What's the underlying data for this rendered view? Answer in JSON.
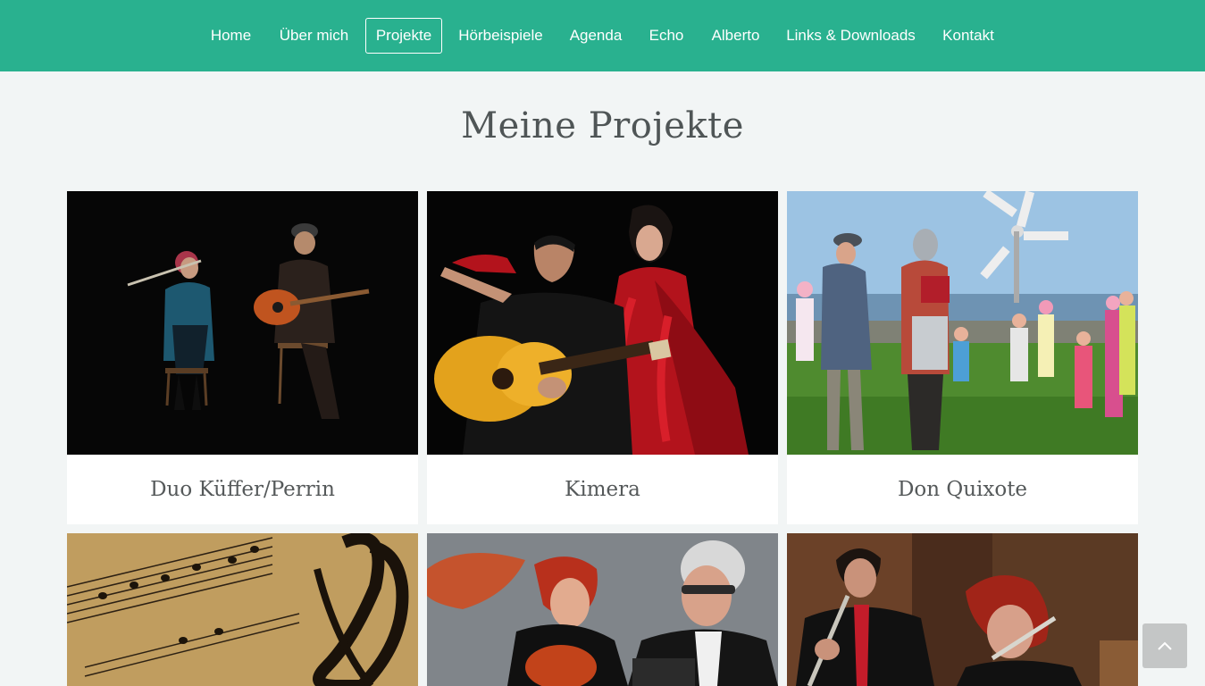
{
  "nav": {
    "items": [
      {
        "label": "Home"
      },
      {
        "label": "Über mich"
      },
      {
        "label": "Projekte",
        "active": true
      },
      {
        "label": "Hörbeispiele"
      },
      {
        "label": "Agenda"
      },
      {
        "label": "Echo"
      },
      {
        "label": "Alberto"
      },
      {
        "label": "Links & Downloads"
      },
      {
        "label": "Kontakt"
      }
    ]
  },
  "page": {
    "title": "Meine Projekte"
  },
  "projects": [
    {
      "title": "Duo Küffer/Perrin"
    },
    {
      "title": "Kimera"
    },
    {
      "title": "Don Quixote"
    },
    {
      "title": ""
    },
    {
      "title": ""
    },
    {
      "title": ""
    }
  ],
  "colors": {
    "nav_background": "#29b18f",
    "page_background": "#f2f5f5",
    "text": "#55595a"
  },
  "icons": {
    "back_to_top": "chevron-up-icon"
  }
}
